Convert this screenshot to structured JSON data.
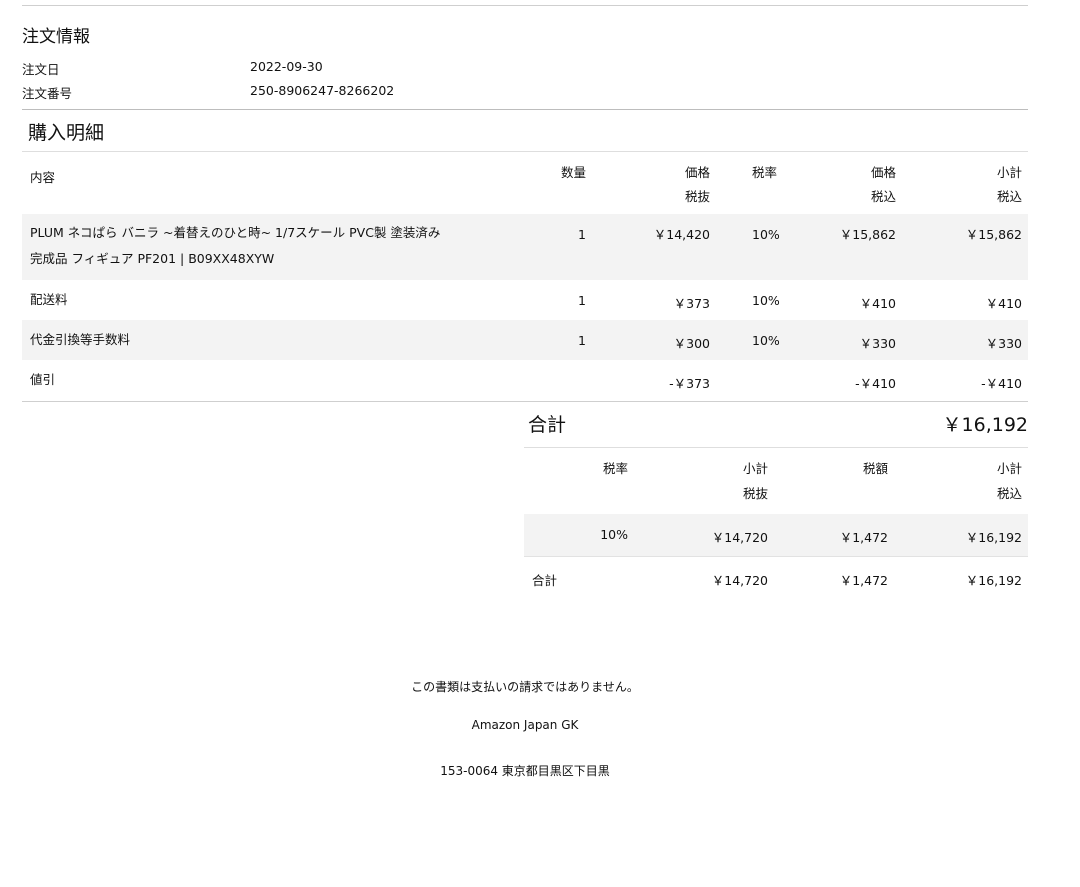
{
  "order_info": {
    "title": "注文情報",
    "date_label": "注文日",
    "date_value": "2022-09-30",
    "number_label": "注文番号",
    "number_value": "250-8906247-8266202"
  },
  "purchase": {
    "title": "購入明細",
    "headers": {
      "description": "内容",
      "quantity": "数量",
      "price_ex_top": "価格",
      "price_ex_bottom": "税抜",
      "tax_rate": "税率",
      "price_in_top": "価格",
      "price_in_bottom": "税込",
      "subtotal_top": "小計",
      "subtotal_bottom": "税込"
    },
    "items": [
      {
        "desc_line1": "PLUM ネコぱら バニラ ~着替えのひと時~ 1/7スケール PVC製 塗装済み",
        "desc_line2": "完成品 フィギュア PF201 | B09XX48XYW",
        "qty": "1",
        "price_ex": "￥14,420",
        "rate": "10%",
        "price_in": "￥15,862",
        "subtotal": "￥15,862"
      },
      {
        "desc_line1": "配送料",
        "qty": "1",
        "price_ex": "￥373",
        "rate": "10%",
        "price_in": "￥410",
        "subtotal": "￥410"
      },
      {
        "desc_line1": "代金引換等手数料",
        "qty": "1",
        "price_ex": "￥300",
        "rate": "10%",
        "price_in": "￥330",
        "subtotal": "￥330"
      },
      {
        "desc_line1": "値引",
        "qty": "",
        "price_ex": "-￥373",
        "rate": "",
        "price_in": "-￥410",
        "subtotal": "-￥410"
      }
    ]
  },
  "total": {
    "label": "合計",
    "value": "￥16,192",
    "tax_headers": {
      "rate": "税率",
      "subtotal_ex_top": "小計",
      "subtotal_ex_bottom": "税抜",
      "tax_amount": "税額",
      "subtotal_in_top": "小計",
      "subtotal_in_bottom": "税込"
    },
    "tax_row": {
      "rate": "10%",
      "subtotal_ex": "￥14,720",
      "tax_amount": "￥1,472",
      "subtotal_in": "￥16,192"
    },
    "sum_row": {
      "label": "合計",
      "subtotal_ex": "￥14,720",
      "tax_amount": "￥1,472",
      "subtotal_in": "￥16,192"
    }
  },
  "footer": {
    "notice": "この書類は支払いの請求ではありません。",
    "company": "Amazon Japan GK",
    "address": "153-0064 東京都目黒区下目黒"
  }
}
